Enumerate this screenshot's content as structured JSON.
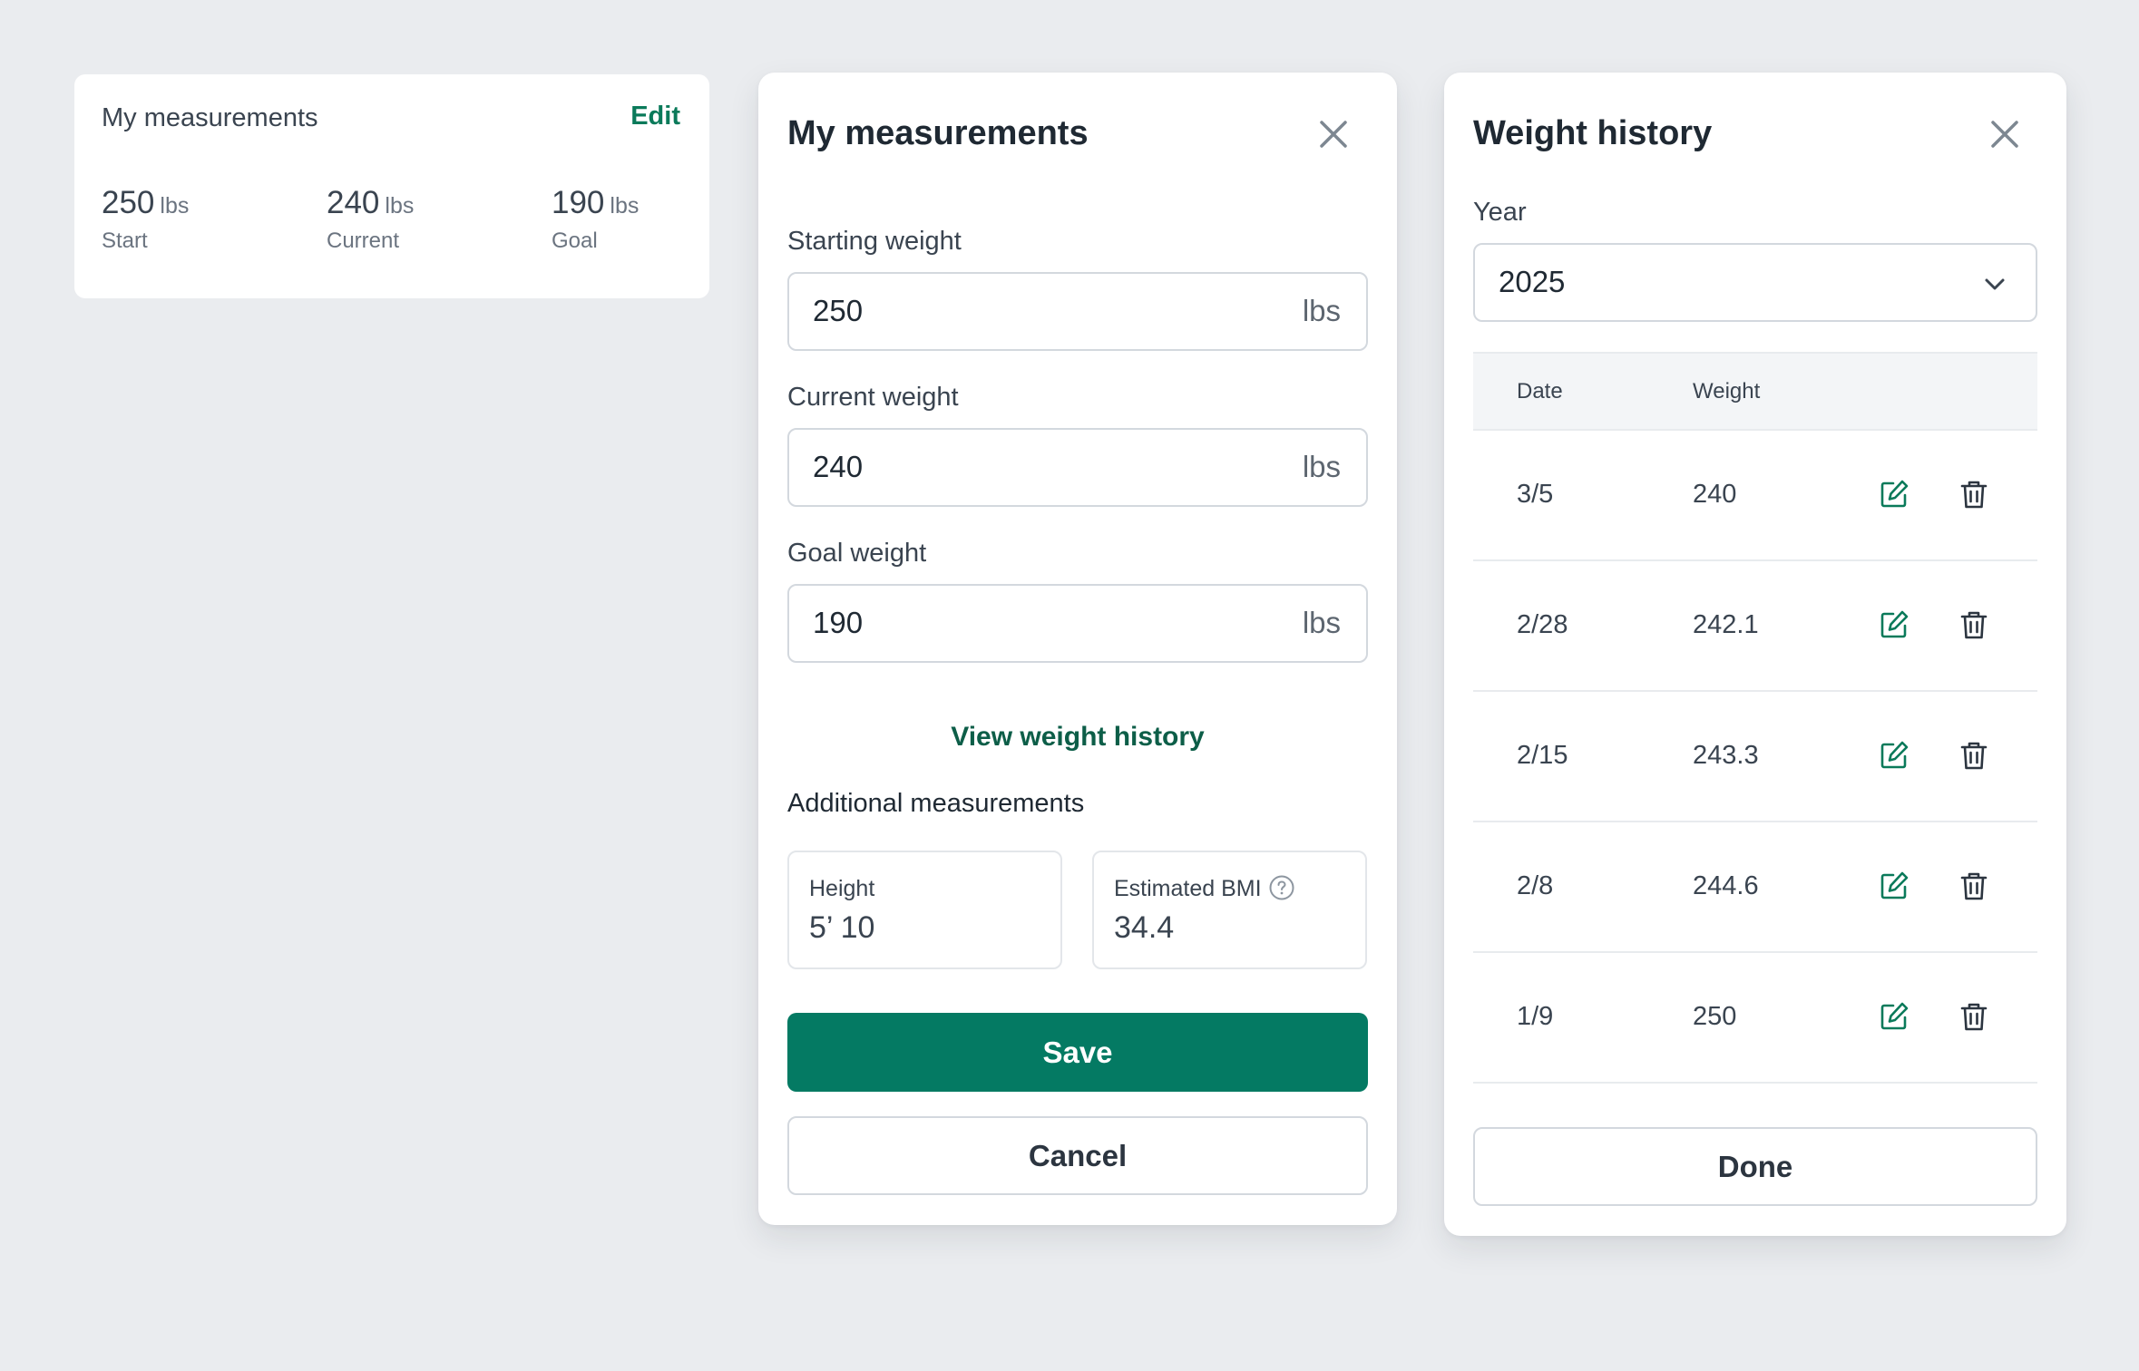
{
  "summary": {
    "title": "My measurements",
    "edit_label": "Edit",
    "stats": [
      {
        "value": "250",
        "unit": "lbs",
        "label": "Start"
      },
      {
        "value": "240",
        "unit": "lbs",
        "label": "Current"
      },
      {
        "value": "190",
        "unit": "lbs",
        "label": "Goal"
      }
    ]
  },
  "measurements_modal": {
    "title": "My measurements",
    "fields": [
      {
        "label": "Starting weight",
        "value": "250",
        "unit": "lbs"
      },
      {
        "label": "Current weight",
        "value": "240",
        "unit": "lbs"
      },
      {
        "label": "Goal weight",
        "value": "190",
        "unit": "lbs"
      }
    ],
    "history_link": "View weight history",
    "additional_label": "Additional measurements",
    "height": {
      "label": "Height",
      "value": "5’ 10"
    },
    "bmi": {
      "label": "Estimated BMI",
      "value": "34.4"
    },
    "save_label": "Save",
    "cancel_label": "Cancel"
  },
  "history_modal": {
    "title": "Weight history",
    "year_label": "Year",
    "year_value": "2025",
    "columns": [
      "Date",
      "Weight"
    ],
    "rows": [
      {
        "date": "3/5",
        "weight": "240"
      },
      {
        "date": "2/28",
        "weight": "242.1"
      },
      {
        "date": "2/15",
        "weight": "243.3"
      },
      {
        "date": "2/8",
        "weight": "244.6"
      },
      {
        "date": "1/9",
        "weight": "250"
      }
    ],
    "done_label": "Done"
  },
  "colors": {
    "accent": "#047a63",
    "link": "#0d5e48",
    "background": "#eaecef"
  },
  "icons": [
    "close-icon",
    "help-icon",
    "chevron-down-icon",
    "edit-icon",
    "trash-icon"
  ]
}
